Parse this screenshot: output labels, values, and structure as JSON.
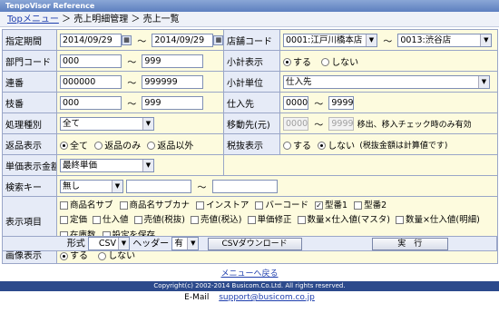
{
  "app_title": "TenpoVisor Reference",
  "breadcrumb": {
    "top": "Topメニュー",
    "sep1": "＞",
    "item1": "売上明細管理",
    "sep2": "＞",
    "item2": "売上一覧"
  },
  "labels": {
    "period": "指定期間",
    "dept": "部門コード",
    "serial": "連番",
    "branch": "枝番",
    "process_type": "処理種別",
    "return_display": "返品表示",
    "price_amount": "単価表示金額",
    "search_key": "検索キー",
    "display_items": "表示項目",
    "image_display": "画像表示",
    "store_code": "店舗コード",
    "subtotal_display": "小計表示",
    "subtotal_unit": "小計単位",
    "supplier": "仕入先",
    "move_dest": "移動先(元)",
    "tax_display": "税抜表示"
  },
  "values": {
    "date_from": "2014/09/29",
    "date_to": "2014/09/29",
    "tilde": "〜",
    "dept_from": "000",
    "dept_to": "999",
    "serial_from": "000000",
    "serial_to": "999999",
    "branch_from": "000",
    "branch_to": "999",
    "process_type": "全て",
    "price_amount": "最終単価",
    "search_key": "無し",
    "search_value": "",
    "search_value2": "",
    "store_from": "0001:江戸川橋本店",
    "store_to": "0013:渋谷店",
    "subtotal_unit": "仕入先",
    "supplier_from": "0000",
    "supplier_to": "9999",
    "move_from": "0000",
    "move_to": "9999",
    "move_note": "移出、移入チェック時のみ有効"
  },
  "radios": {
    "return": [
      "全て",
      "返品のみ",
      "返品以外"
    ],
    "subtotal": [
      "する",
      "しない"
    ],
    "tax": [
      "する",
      "しない",
      "(税抜金額は計算値です)"
    ],
    "image": [
      "する",
      "しない"
    ]
  },
  "display_items": {
    "row1": [
      "商品名サブ",
      "商品名サブカナ",
      "インストア",
      "バーコード",
      "型番1",
      "型番2"
    ],
    "row2": [
      "定価",
      "仕入値",
      "売値(税抜)",
      "売値(税込)",
      "単価修正",
      "数量×仕入値(マスタ)",
      "数量×仕入値(明細)"
    ],
    "row3": [
      "在庫数",
      "設定を保存"
    ]
  },
  "bottom_bar": {
    "format_label": "形式",
    "format_value": "CSV",
    "header_label": "ヘッダー",
    "header_value": "有",
    "csv_button": "CSVダウンロード",
    "run_button": "実　行"
  },
  "back_link": "メニューへ戻る",
  "footer_copyright": "Copyright(c) 2002-2014 Busicom.Co.Ltd. All rights reserved.",
  "email_label": "E-Mail",
  "email_address": "support@busicom.co.jp"
}
